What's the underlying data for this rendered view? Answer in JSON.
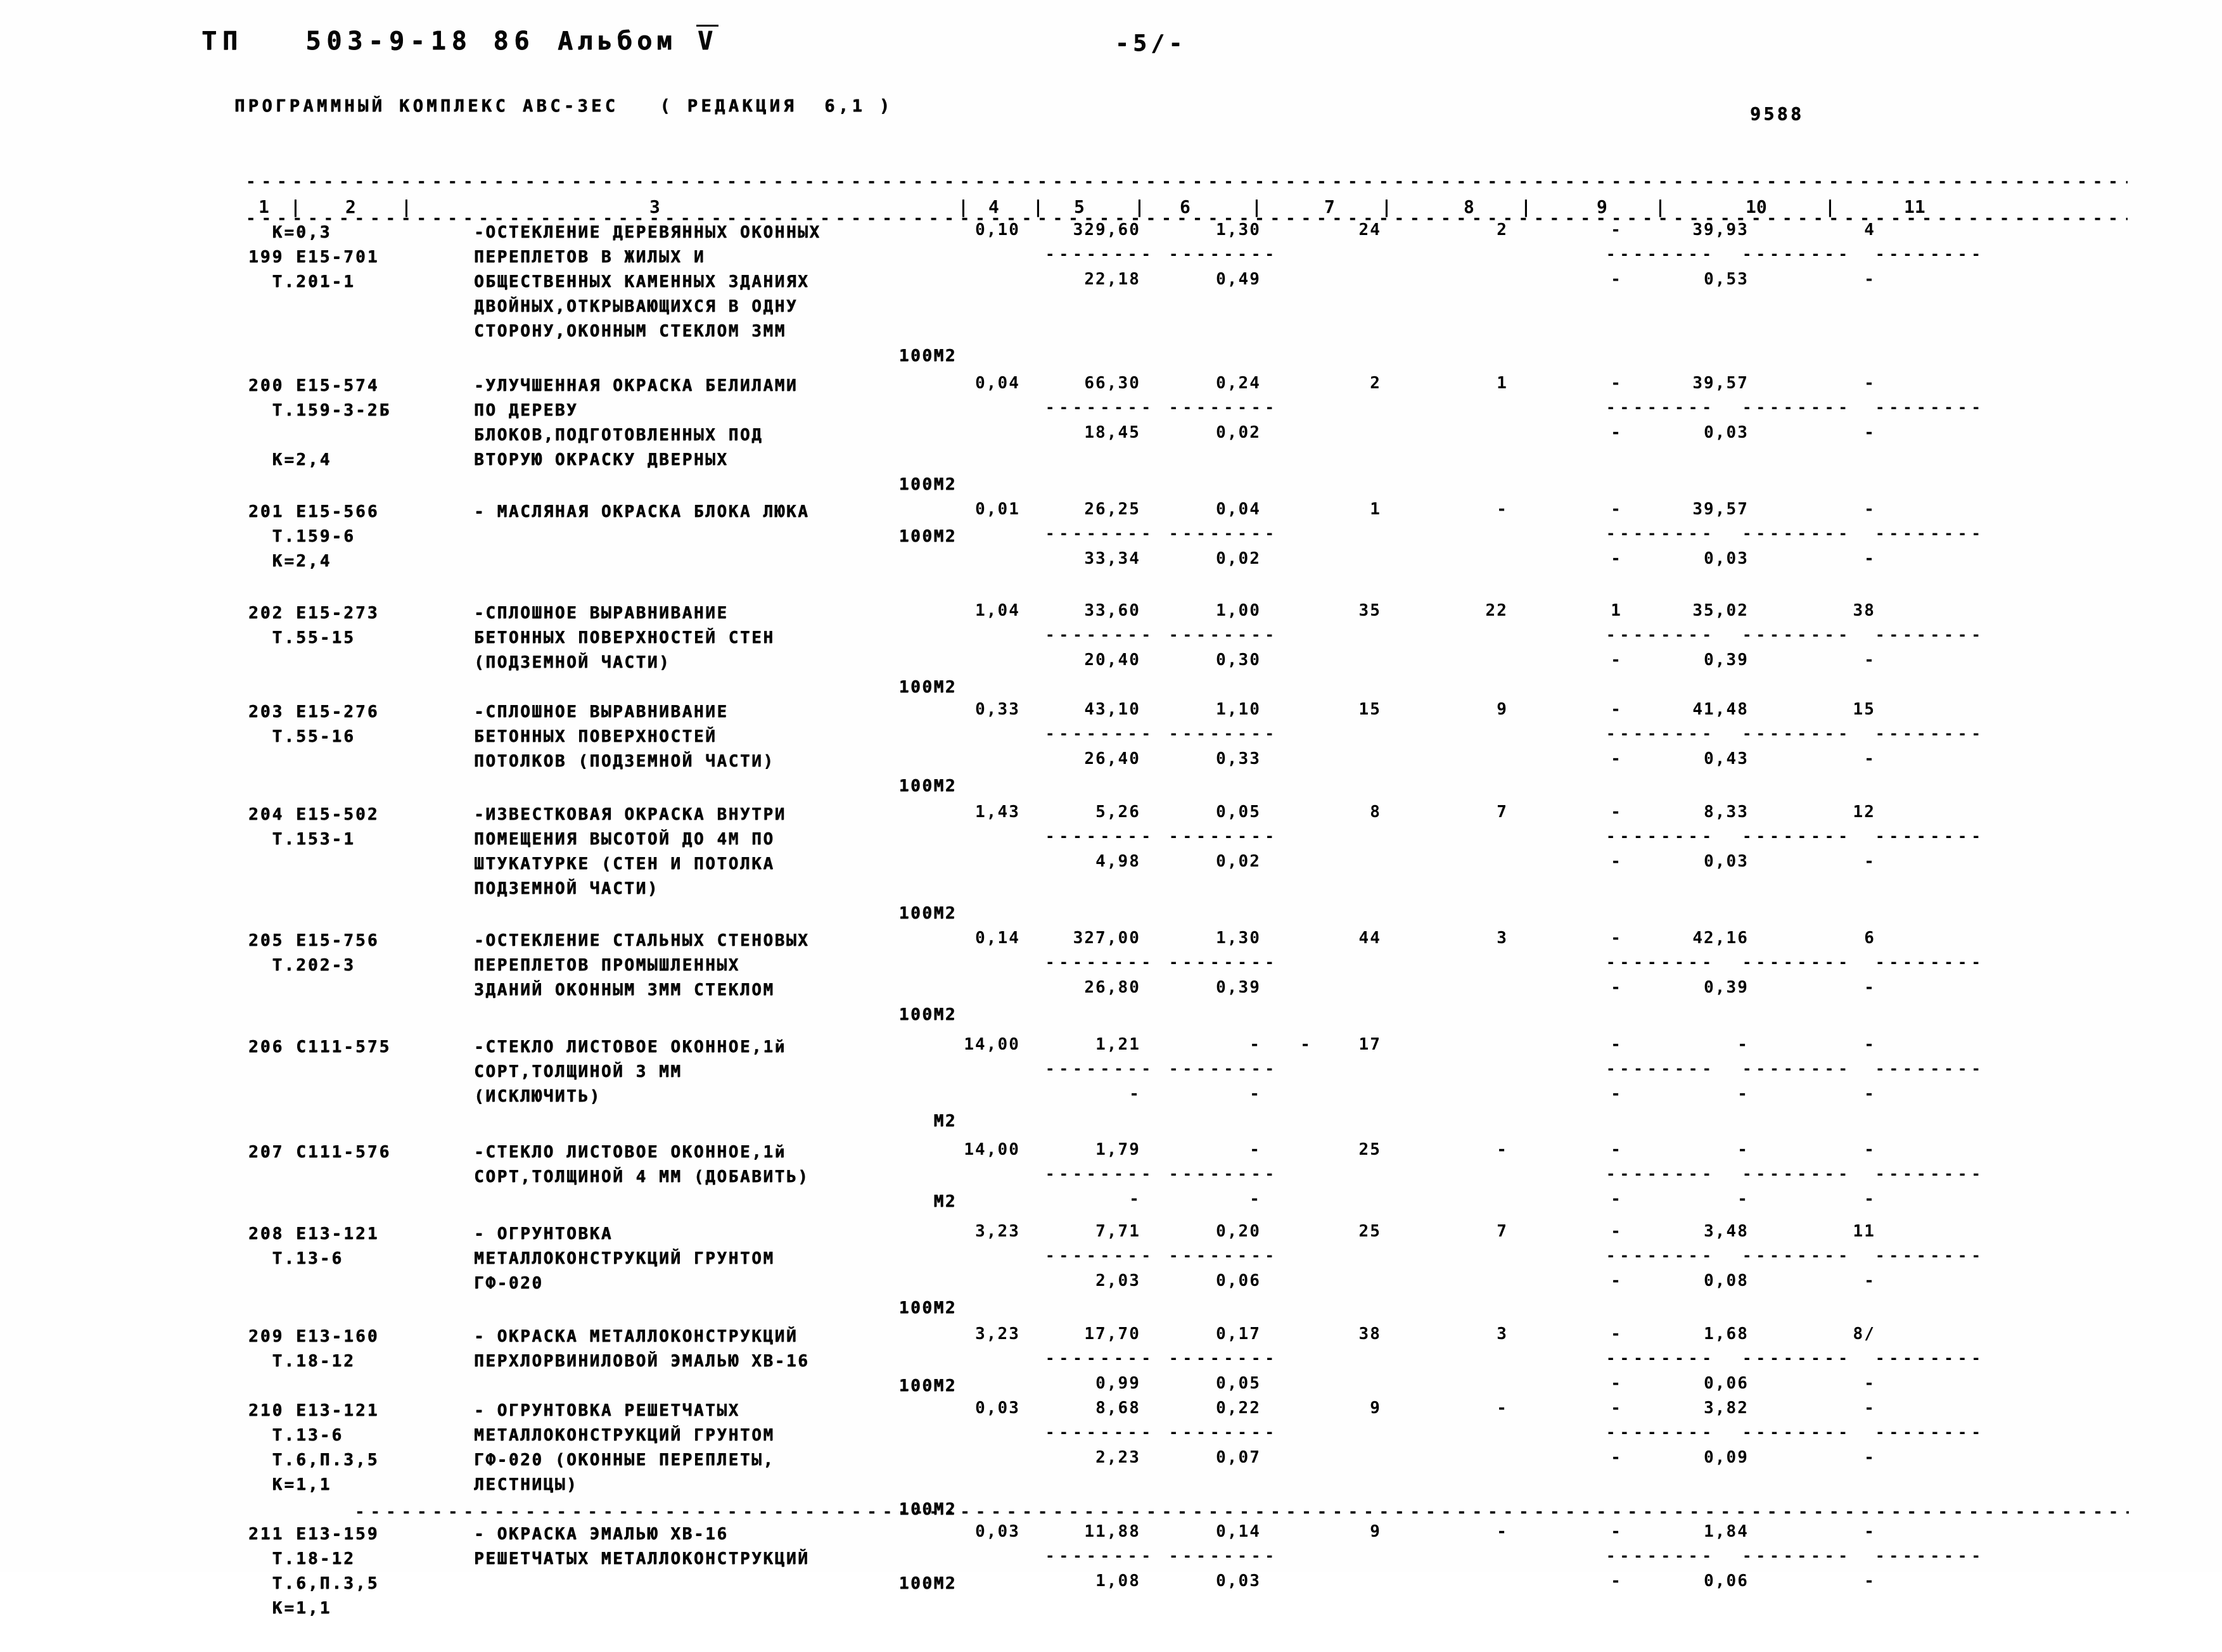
{
  "header": {
    "doc_code": "ТП   503-9-18 86",
    "album_label": "Альбом",
    "album_number": "V",
    "page_marker": "-5/-",
    "software_line": "ПРОГРАММНЫЙ КОМПЛЕКС АВС-ЗЕС   ( РЕДАКЦИЯ  6,1 )",
    "sheet_code": "9588"
  },
  "table": {
    "column_numbers": [
      "1",
      "2",
      "3",
      "4",
      "5",
      "6",
      "7",
      "8",
      "9",
      "10",
      "11"
    ],
    "rows": [
      {
        "coef": "К=0,3",
        "code_lines": [
          "199 Е15-701",
          "Т.201-1"
        ],
        "desc_lines": [
          "-ОСТЕКЛЕНИЕ ДЕРЕВЯННЫХ ОКОННЫХ",
          "ПЕРЕПЛЕТОВ В ЖИЛЫХ И",
          "ОБЩЕСТВЕННЫХ КАМЕННЫХ ЗДАНИЯХ",
          "ДВОЙНЫХ,ОТКРЫВАЮЩИХСЯ В ОДНУ",
          "СТОРОНУ,ОКОННЫМ СТЕКЛОМ 3ММ"
        ],
        "unit": "100М2",
        "v4": "0,10",
        "v5": "329,60",
        "v6": "1,30",
        "v7": "24",
        "v8": "2",
        "v9": "-",
        "v10": "39,93",
        "v11": "4",
        "w5": "22,18",
        "w6": "0,49",
        "w9": "-",
        "w10": "0,53",
        "w11": "-"
      },
      {
        "coef": "К=2,4",
        "code_lines": [
          "200 Е15-574",
          "Т.159-3-2Б"
        ],
        "desc_lines": [
          "-УЛУЧШЕННАЯ ОКРАСКА БЕЛИЛАМИ",
          "ПО ДЕРЕВУ",
          "БЛОКОВ,ПОДГОТОВЛЕННЫХ ПОД",
          "ВТОРУЮ ОКРАСКУ ДВЕРНЫХ"
        ],
        "unit": "100М2",
        "v4": "0,04",
        "v5": "66,30",
        "v6": "0,24",
        "v7": "2",
        "v8": "1",
        "v9": "-",
        "v10": "39,57",
        "v11": "-",
        "w5": "18,45",
        "w6": "0,02",
        "w9": "-",
        "w10": "0,03",
        "w11": "-"
      },
      {
        "coef": "К=2,4",
        "code_lines": [
          "201 Е15-566",
          "Т.159-6"
        ],
        "desc_lines": [
          "- МАСЛЯНАЯ ОКРАСКА БЛОКА ЛЮКА"
        ],
        "unit": "100М2",
        "v4": "0,01",
        "v5": "26,25",
        "v6": "0,04",
        "v7": "1",
        "v8": "-",
        "v9": "-",
        "v10": "39,57",
        "v11": "-",
        "w5": "33,34",
        "w6": "0,02",
        "w9": "-",
        "w10": "0,03",
        "w11": "-"
      },
      {
        "coef": "",
        "code_lines": [
          "202 Е15-273",
          "Т.55-15"
        ],
        "desc_lines": [
          "-СПЛОШНОЕ ВЫРАВНИВАНИЕ",
          "БЕТОННЫХ ПОВЕРХНОСТЕЙ СТЕН",
          "(ПОДЗЕМНОЙ ЧАСТИ)"
        ],
        "unit": "100М2",
        "v4": "1,04",
        "v5": "33,60",
        "v6": "1,00",
        "v7": "35",
        "v8": "22",
        "v9": "1",
        "v10": "35,02",
        "v11": "38",
        "w5": "20,40",
        "w6": "0,30",
        "w9": "-",
        "w10": "0,39",
        "w11": "-"
      },
      {
        "coef": "",
        "code_lines": [
          "203 Е15-276",
          "Т.55-16"
        ],
        "desc_lines": [
          "-СПЛОШНОЕ ВЫРАВНИВАНИЕ",
          "БЕТОННЫХ ПОВЕРХНОСТЕЙ",
          "ПОТОЛКОВ (ПОДЗЕМНОЙ ЧАСТИ)"
        ],
        "unit": "100М2",
        "v4": "0,33",
        "v5": "43,10",
        "v6": "1,10",
        "v7": "15",
        "v8": "9",
        "v9": "-",
        "v10": "41,48",
        "v11": "15",
        "w5": "26,40",
        "w6": "0,33",
        "w9": "-",
        "w10": "0,43",
        "w11": "-"
      },
      {
        "coef": "",
        "code_lines": [
          "204 Е15-502",
          "Т.153-1"
        ],
        "desc_lines": [
          "-ИЗВЕСТКОВАЯ ОКРАСКА ВНУТРИ",
          "ПОМЕЩЕНИЯ ВЫСОТОЙ ДО 4М ПО",
          "ШТУКАТУРКЕ (СТЕН И ПОТОЛКА",
          "ПОДЗЕМНОЙ ЧАСТИ)"
        ],
        "unit": "100М2",
        "v4": "1,43",
        "v5": "5,26",
        "v6": "0,05",
        "v7": "8",
        "v8": "7",
        "v9": "-",
        "v10": "8,33",
        "v11": "12",
        "w5": "4,98",
        "w6": "0,02",
        "w9": "-",
        "w10": "0,03",
        "w11": "-"
      },
      {
        "coef": "",
        "code_lines": [
          "205 Е15-756",
          "Т.202-3"
        ],
        "desc_lines": [
          "-ОСТЕКЛЕНИЕ СТАЛЬНЫХ СТЕНОВЫХ",
          "ПЕРЕПЛЕТОВ ПРОМЫШЛЕННЫХ",
          "ЗДАНИЙ ОКОННЫМ 3ММ СТЕКЛОМ"
        ],
        "unit": "100М2",
        "v4": "0,14",
        "v5": "327,00",
        "v6": "1,30",
        "v7": "44",
        "v8": "3",
        "v9": "-",
        "v10": "42,16",
        "v11": "6",
        "w5": "26,80",
        "w6": "0,39",
        "w9": "-",
        "w10": "0,39",
        "w11": "-"
      },
      {
        "coef": "",
        "code_lines": [
          "206 С111-575"
        ],
        "desc_lines": [
          "-СТЕКЛО ЛИСТОВОЕ ОКОННОЕ,1й",
          "СОРТ,ТОЛЩИНОЙ 3 ММ",
          "(ИСКЛЮЧИТЬ)"
        ],
        "unit": "М2",
        "v4": "14,00",
        "v5": "1,21",
        "v6": "-",
        "v6b": "-",
        "v7": "17",
        "v8": "",
        "v9": "-",
        "v10": "-",
        "v11": "-",
        "w5": "-",
        "w6": "-",
        "w9": "-",
        "w10": "-",
        "w11": "-"
      },
      {
        "coef": "",
        "code_lines": [
          "207 С111-576"
        ],
        "desc_lines": [
          "-СТЕКЛО ЛИСТОВОЕ ОКОННОЕ,1й",
          "СОРТ,ТОЛЩИНОЙ 4 ММ (ДОБАВИТЬ)"
        ],
        "unit": "М2",
        "v4": "14,00",
        "v5": "1,79",
        "v6": "-",
        "v7": "25",
        "v8": "-",
        "v9": "-",
        "v10": "-",
        "v11": "-",
        "w5": "-",
        "w6": "-",
        "w9": "-",
        "w10": "-",
        "w11": "-"
      },
      {
        "coef": "",
        "code_lines": [
          "208 Е13-121",
          "Т.13-6"
        ],
        "desc_lines": [
          "- ОГРУНТОВКА",
          "МЕТАЛЛОКОНСТРУКЦИЙ ГРУНТОМ",
          "ГФ-020"
        ],
        "unit": "100М2",
        "v4": "3,23",
        "v5": "7,71",
        "v6": "0,20",
        "v7": "25",
        "v8": "7",
        "v9": "-",
        "v10": "3,48",
        "v11": "11",
        "w5": "2,03",
        "w6": "0,06",
        "w9": "-",
        "w10": "0,08",
        "w11": "-"
      },
      {
        "coef": "",
        "code_lines": [
          "209 Е13-160",
          "Т.18-12"
        ],
        "desc_lines": [
          "- ОКРАСКА МЕТАЛЛОКОНСТРУКЦИЙ",
          "ПЕРХЛОРВИНИЛОВОЙ ЭМАЛЬЮ ХВ-16"
        ],
        "unit": "100М2",
        "v4": "3,23",
        "v5": "17,70",
        "v6": "0,17",
        "v7": "38",
        "v8": "3",
        "v9": "-",
        "v10": "1,68",
        "v11": "8/",
        "w5": "0,99",
        "w6": "0,05",
        "w9": "-",
        "w10": "0,06",
        "w11": "-"
      },
      {
        "coef": "К=1,1",
        "code_lines": [
          "210 Е13-121",
          "Т.13-6",
          "Т.6,П.3,5"
        ],
        "desc_lines": [
          "- ОГРУНТОВКА РЕШЕТЧАТЫХ",
          "МЕТАЛЛОКОНСТРУКЦИЙ ГРУНТОМ",
          "ГФ-020 (ОКОННЫЕ ПЕРЕПЛЕТЫ,",
          "ЛЕСТНИЦЫ)"
        ],
        "unit": "100М2",
        "v4": "0,03",
        "v5": "8,68",
        "v6": "0,22",
        "v7": "9",
        "v8": "-",
        "v9": "-",
        "v10": "3,82",
        "v11": "-",
        "w5": "2,23",
        "w6": "0,07",
        "w9": "-",
        "w10": "0,09",
        "w11": "-"
      },
      {
        "coef": "К=1,1",
        "code_lines": [
          "211 Е13-159",
          "Т.18-12",
          "Т.6,П.3,5"
        ],
        "desc_lines": [
          "- ОКРАСКА ЭМАЛЬЮ ХВ-16",
          "РЕШЕТЧАТЫХ МЕТАЛЛОКОНСТРУКЦИЙ"
        ],
        "unit": "100М2",
        "v4": "0,03",
        "v5": "11,88",
        "v6": "0,14",
        "v7": "9",
        "v8": "-",
        "v9": "-",
        "v10": "1,84",
        "v11": "-",
        "w5": "1,08",
        "w6": "0,03",
        "w9": "-",
        "w10": "0,06",
        "w11": "-"
      }
    ]
  }
}
